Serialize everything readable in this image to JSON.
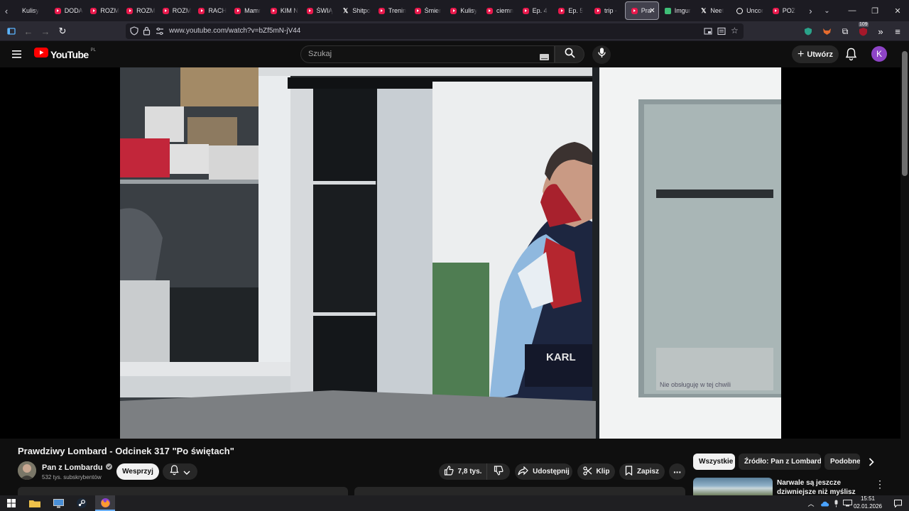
{
  "browser": {
    "tabs": [
      {
        "label": "Kulisy",
        "icon": "none"
      },
      {
        "label": "DODA",
        "icon": "youtube"
      },
      {
        "label": "ROZM",
        "icon": "youtube"
      },
      {
        "label": "ROZM",
        "icon": "youtube"
      },
      {
        "label": "ROZM",
        "icon": "youtube"
      },
      {
        "label": "RACH",
        "icon": "youtube"
      },
      {
        "label": "Mamr",
        "icon": "youtube"
      },
      {
        "label": "KIM N",
        "icon": "youtube"
      },
      {
        "label": "ŚWIĄ",
        "icon": "youtube"
      },
      {
        "label": "Shitpo",
        "icon": "x"
      },
      {
        "label": "Trenin",
        "icon": "youtube"
      },
      {
        "label": "Śmier",
        "icon": "youtube"
      },
      {
        "label": "Kulisy",
        "icon": "youtube"
      },
      {
        "label": "ciemn",
        "icon": "youtube"
      },
      {
        "label": "Ep. 4",
        "icon": "youtube"
      },
      {
        "label": "Ep. 5",
        "icon": "youtube"
      },
      {
        "label": "trip -",
        "icon": "youtube"
      },
      {
        "label": "Pra",
        "icon": "youtube",
        "active": true
      },
      {
        "label": "Imgur",
        "icon": "imgur"
      },
      {
        "label": "Neet",
        "icon": "x"
      },
      {
        "label": "Uncor",
        "icon": "circle"
      },
      {
        "label": "POZ",
        "icon": "youtube"
      }
    ],
    "url": "www.youtube.com/watch?v=bZf5mN-jV44",
    "extension_badge": "109"
  },
  "youtube": {
    "logo_text": "YouTube",
    "region": "PL",
    "search_placeholder": "Szukaj",
    "create_label": "Utwórz",
    "account_initial": "K",
    "video_title": "Prawdziwy Lombard - Odcinek 317 \"Po świętach\"",
    "channel_name": "Pan z Lombardu",
    "subscribers": "532 tys. subskrybentów",
    "join_label": "Wesprzyj",
    "likes": "7,8 tys.",
    "share_label": "Udostępnij",
    "clip_label": "Klip",
    "save_label": "Zapisz",
    "chips": [
      "Wszystkie",
      "Źródło: Pan z Lombardu",
      "Podobne"
    ],
    "recommended_title": "Narwale są jeszcze dziwniejsze niż myślisz"
  },
  "video_frame": {
    "sign_text": "Nie obsługuję w tej chwili",
    "hoodie_text": "KARL"
  },
  "taskbar": {
    "time": "15:51",
    "date": "02.01.2026"
  }
}
